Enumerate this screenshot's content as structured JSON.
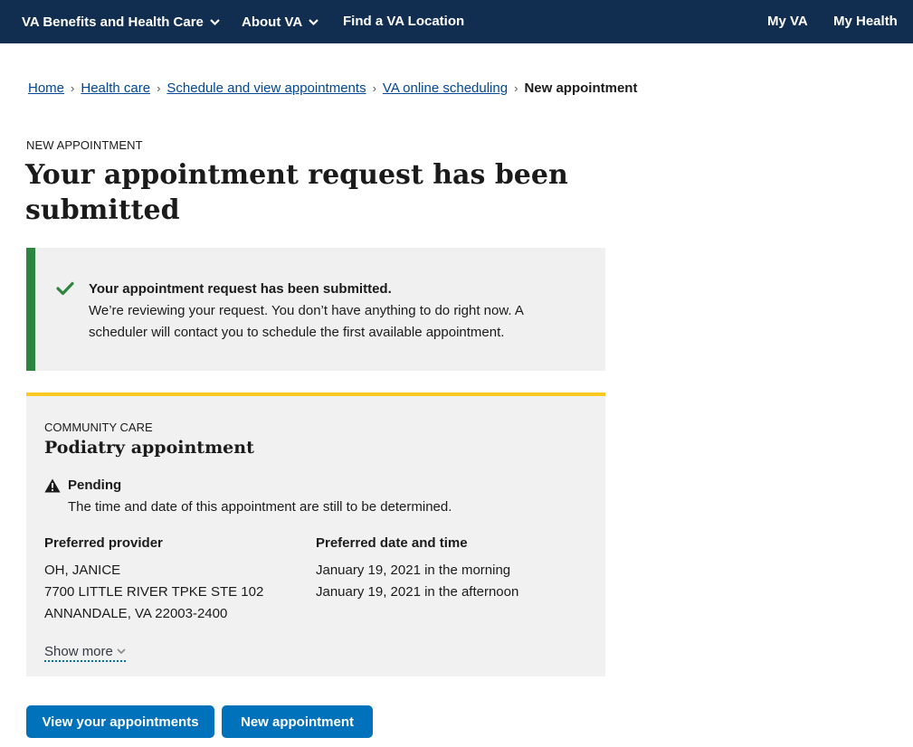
{
  "nav": {
    "benefits": "VA Benefits and Health Care",
    "about": "About VA",
    "find_location": "Find a VA Location",
    "my_va": "My VA",
    "my_health": "My Health"
  },
  "breadcrumb": {
    "items": [
      "Home",
      "Health care",
      "Schedule and view appointments",
      "VA online scheduling"
    ],
    "current": "New appointment",
    "separator": "›"
  },
  "page": {
    "eyebrow": "NEW APPOINTMENT",
    "title": "Your appointment request has been submitted"
  },
  "alert": {
    "title": "Your appointment request has been submitted.",
    "body": "We’re reviewing your request. You don’t have anything to do right now. A scheduler will contact you to schedule the first available appointment."
  },
  "appointment": {
    "type": "COMMUNITY CARE",
    "title": "Podiatry appointment",
    "status": "Pending",
    "status_description": "The time and date of this appointment are still to be determined.",
    "provider_heading": "Preferred provider",
    "provider_lines": [
      "OH, JANICE",
      "7700 LITTLE RIVER TPKE STE 102",
      "ANNANDALE, VA 22003-2400"
    ],
    "datetime_heading": "Preferred date and time",
    "datetime_lines": [
      "January 19, 2021 in the morning",
      "January 19, 2021 in the afternoon"
    ],
    "show_more": "Show more"
  },
  "actions": {
    "view_appointments": "View your appointments",
    "new_appointment": "New appointment"
  },
  "colors": {
    "nav_bg": "#112e51",
    "success": "#2e8540",
    "warning_border": "#fac922",
    "primary_button": "#0071bb",
    "link": "#004795"
  },
  "icons": [
    "chevron-down-icon",
    "check-icon",
    "warning-icon"
  ]
}
